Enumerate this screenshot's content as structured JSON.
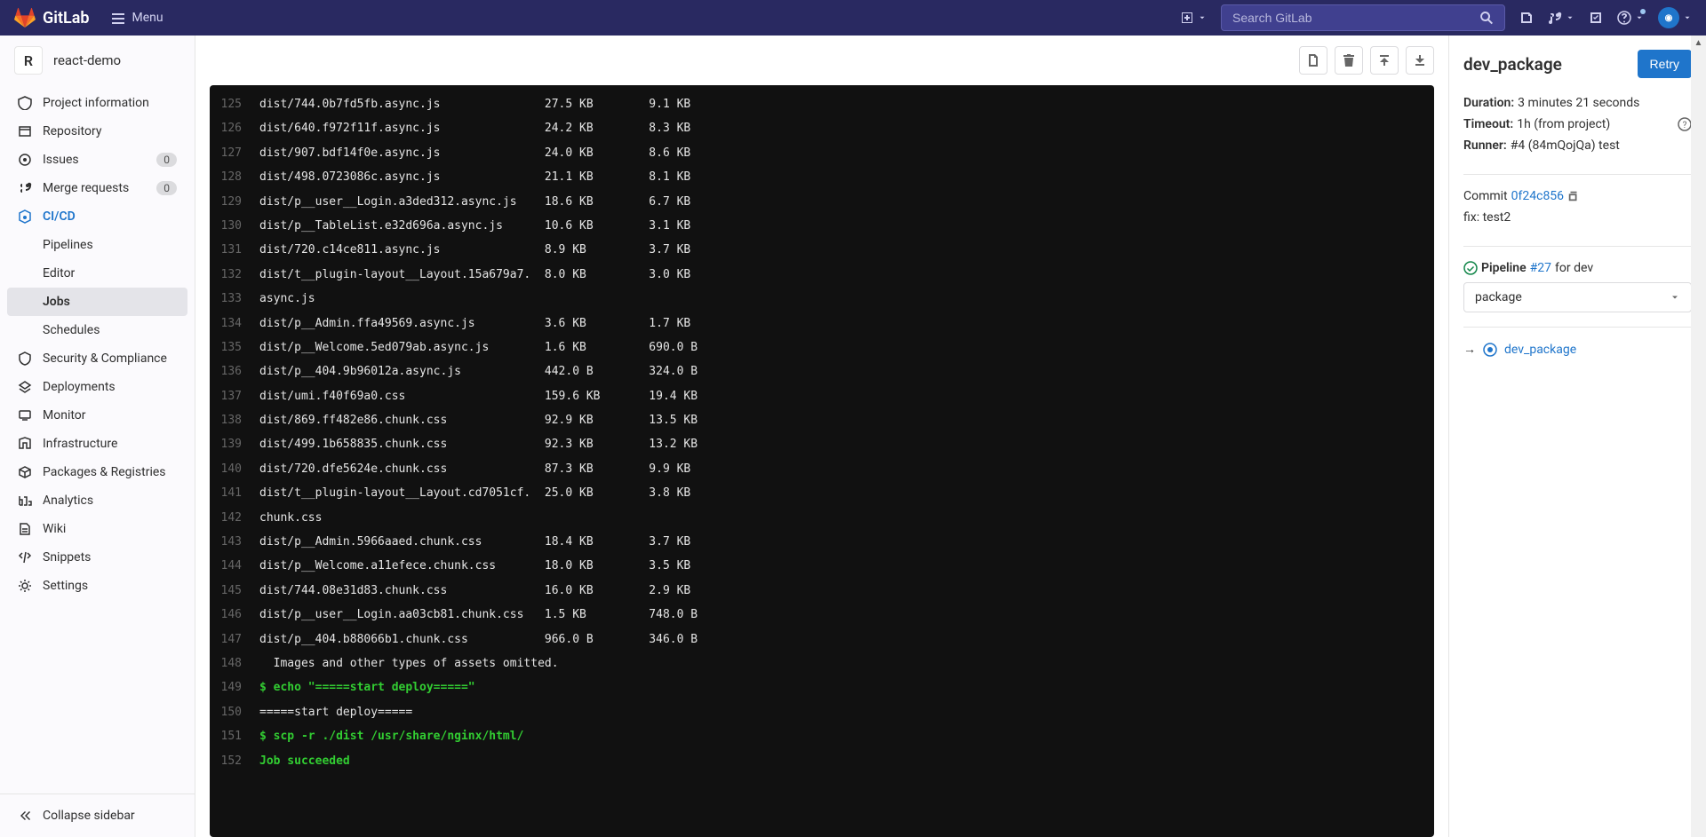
{
  "topbar": {
    "brand": "GitLab",
    "menu": "Menu",
    "search_placeholder": "Search GitLab"
  },
  "sidebar": {
    "project_avatar": "R",
    "project_name": "react-demo",
    "items": [
      {
        "label": "Project information"
      },
      {
        "label": "Repository"
      },
      {
        "label": "Issues",
        "badge": "0"
      },
      {
        "label": "Merge requests",
        "badge": "0"
      },
      {
        "label": "CI/CD"
      },
      {
        "label": "Pipelines"
      },
      {
        "label": "Editor"
      },
      {
        "label": "Jobs"
      },
      {
        "label": "Schedules"
      },
      {
        "label": "Security & Compliance"
      },
      {
        "label": "Deployments"
      },
      {
        "label": "Monitor"
      },
      {
        "label": "Infrastructure"
      },
      {
        "label": "Packages & Registries"
      },
      {
        "label": "Analytics"
      },
      {
        "label": "Wiki"
      },
      {
        "label": "Snippets"
      },
      {
        "label": "Settings"
      }
    ],
    "collapse": "Collapse sidebar"
  },
  "log_lines": [
    {
      "n": "125",
      "t": "dist/744.0b7fd5fb.async.js               27.5 KB        9.1 KB"
    },
    {
      "n": "126",
      "t": "dist/640.f972f11f.async.js               24.2 KB        8.3 KB"
    },
    {
      "n": "127",
      "t": "dist/907.bdf14f0e.async.js               24.0 KB        8.6 KB"
    },
    {
      "n": "128",
      "t": "dist/498.0723086c.async.js               21.1 KB        8.1 KB"
    },
    {
      "n": "129",
      "t": "dist/p__user__Login.a3ded312.async.js    18.6 KB        6.7 KB"
    },
    {
      "n": "130",
      "t": "dist/p__TableList.e32d696a.async.js      10.6 KB        3.1 KB"
    },
    {
      "n": "131",
      "t": "dist/720.c14ce811.async.js               8.9 KB         3.7 KB"
    },
    {
      "n": "132",
      "t": "dist/t__plugin-layout__Layout.15a679a7.  8.0 KB         3.0 KB"
    },
    {
      "n": "133",
      "t": "async.js"
    },
    {
      "n": "134",
      "t": "dist/p__Admin.ffa49569.async.js          3.6 KB         1.7 KB"
    },
    {
      "n": "135",
      "t": "dist/p__Welcome.5ed079ab.async.js        1.6 KB         690.0 B"
    },
    {
      "n": "136",
      "t": "dist/p__404.9b96012a.async.js            442.0 B        324.0 B"
    },
    {
      "n": "137",
      "t": "dist/umi.f40f69a0.css                    159.6 KB       19.4 KB"
    },
    {
      "n": "138",
      "t": "dist/869.ff482e86.chunk.css              92.9 KB        13.5 KB"
    },
    {
      "n": "139",
      "t": "dist/499.1b658835.chunk.css              92.3 KB        13.2 KB"
    },
    {
      "n": "140",
      "t": "dist/720.dfe5624e.chunk.css              87.3 KB        9.9 KB"
    },
    {
      "n": "141",
      "t": "dist/t__plugin-layout__Layout.cd7051cf.  25.0 KB        3.8 KB"
    },
    {
      "n": "142",
      "t": "chunk.css"
    },
    {
      "n": "143",
      "t": "dist/p__Admin.5966aaed.chunk.css         18.4 KB        3.7 KB"
    },
    {
      "n": "144",
      "t": "dist/p__Welcome.a11efece.chunk.css       18.0 KB        3.5 KB"
    },
    {
      "n": "145",
      "t": "dist/744.08e31d83.chunk.css              16.0 KB        2.9 KB"
    },
    {
      "n": "146",
      "t": "dist/p__user__Login.aa03cb81.chunk.css   1.5 KB         748.0 B"
    },
    {
      "n": "147",
      "t": "dist/p__404.b88066b1.chunk.css           966.0 B        346.0 B"
    },
    {
      "n": "148",
      "t": "  Images and other types of assets omitted."
    },
    {
      "n": "149",
      "t": "$ echo \"=====start deploy=====\"",
      "cmd": true
    },
    {
      "n": "150",
      "t": "=====start deploy====="
    },
    {
      "n": "151",
      "t": "$ scp -r ./dist /usr/share/nginx/html/",
      "cmd": true
    },
    {
      "n": "152",
      "t": "Job succeeded",
      "ok": true
    }
  ],
  "right": {
    "title": "dev_package",
    "retry": "Retry",
    "duration_label": "Duration:",
    "duration_value": "3 minutes 21 seconds",
    "timeout_label": "Timeout:",
    "timeout_value": "1h (from project)",
    "runner_label": "Runner:",
    "runner_value": "#4 (84mQojQa) test",
    "commit_label": "Commit",
    "commit_hash": "0f24c856",
    "commit_msg": "fix: test2",
    "pipeline_label": "Pipeline",
    "pipeline_id": "#27",
    "pipeline_branch": "for dev",
    "stage_select": "package",
    "job_link": "dev_package"
  }
}
